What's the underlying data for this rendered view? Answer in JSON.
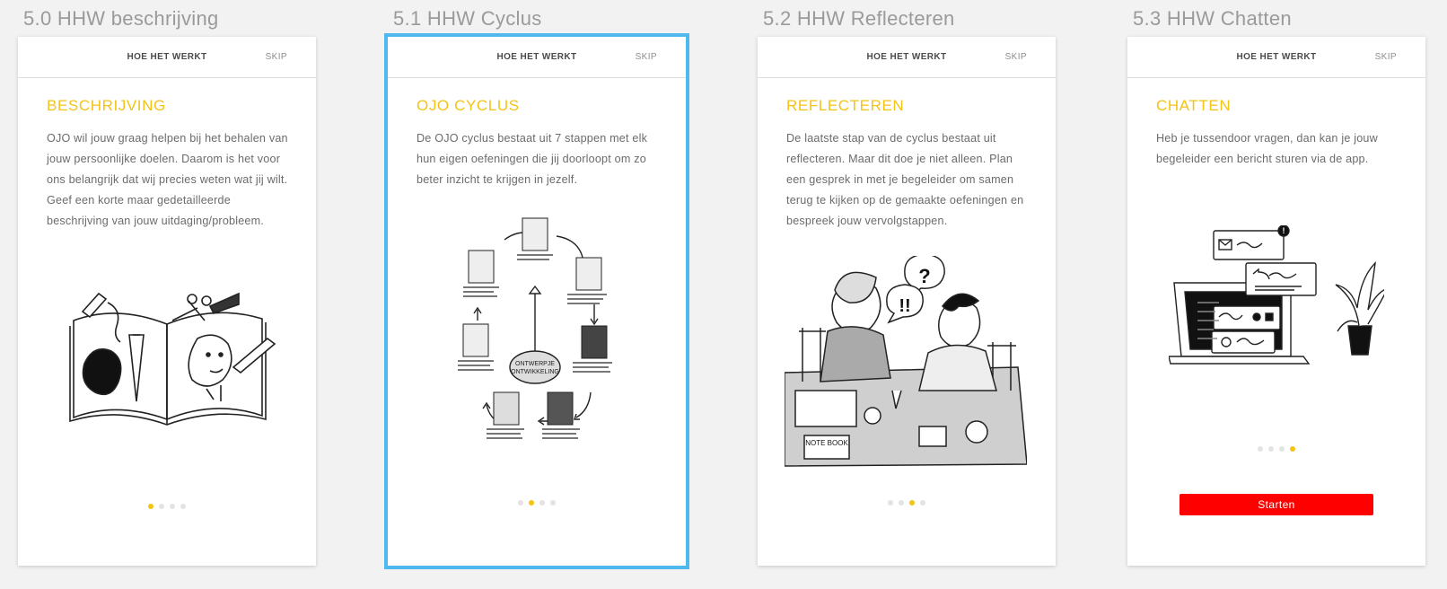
{
  "artboards": [
    {
      "label": "5.0 HHW beschrijving",
      "nav_title": "HOE HET WERKT",
      "skip": "SKIP",
      "heading": "BESCHRIJVING",
      "body": "OJO wil jouw graag helpen bij het behalen van jouw persoonlijke doelen. Daarom is het voor ons belangrijk dat wij precies weten wat jij wilt. Geef een korte maar gedetailleerde beschrijving van jouw uitdaging/probleem.",
      "page_index": 1,
      "page_count": 4
    },
    {
      "label": "5.1 HHW Cyclus",
      "nav_title": "HOE HET WERKT",
      "skip": "SKIP",
      "heading": "OJO CYCLUS",
      "body": "De OJO cyclus bestaat uit 7 stappen met elk hun eigen oefeningen die jij doorloopt om zo beter inzicht te krijgen in jezelf.",
      "center_label_1": "ONTWERPJE",
      "center_label_2": "ONTWIKKELING",
      "page_index": 2,
      "page_count": 4,
      "selected": true
    },
    {
      "label": "5.2 HHW Reflecteren",
      "nav_title": "HOE HET WERKT",
      "skip": "SKIP",
      "heading": "REFLECTEREN",
      "body": "De laatste stap van de cyclus bestaat uit reflecteren. Maar dit doe je niet alleen. Plan een gesprek in met je begeleider om samen terug te kijken op de gemaakte oefeningen en bespreek jouw vervolgstappen.",
      "bubble_question": "?",
      "bubble_exclaim": "!!",
      "notebook_label": "NOTE BOOK",
      "page_index": 3,
      "page_count": 4
    },
    {
      "label": "5.3 HHW Chatten",
      "nav_title": "HOE HET WERKT",
      "skip": "SKIP",
      "heading": "CHATTEN",
      "body": "Heb je tussendoor vragen, dan kan je jouw begeleider een bericht sturen via de app.",
      "start_button": "Starten",
      "notification": "!",
      "page_index": 4,
      "page_count": 4
    }
  ],
  "colors": {
    "accent_yellow": "#f3c316",
    "selection_blue": "#4fb8ec",
    "button_red": "#ff0000",
    "dot_inactive": "#e3e3e3"
  }
}
